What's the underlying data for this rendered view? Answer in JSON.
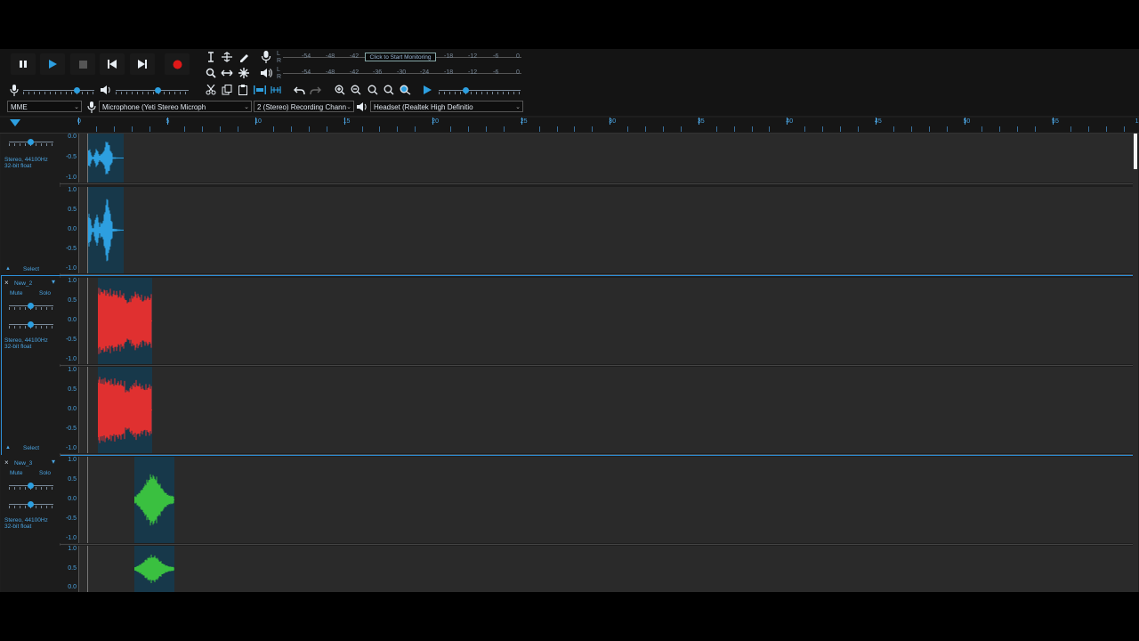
{
  "transport": {
    "pause": "pause-icon",
    "play": "play-icon",
    "stop": "stop-icon",
    "skip_start": "skip-start-icon",
    "skip_end": "skip-end-icon",
    "record": "record-icon"
  },
  "meters": {
    "record_labels": [
      "-54",
      "-48",
      "-42",
      "-18",
      "-12",
      "-6",
      "0"
    ],
    "monitor_button": "Click to Start Monitoring",
    "play_labels": [
      "-54",
      "-48",
      "-42",
      "-36",
      "-30",
      "-24",
      "-18",
      "-12",
      "-6",
      "0"
    ],
    "lr": [
      "L",
      "R"
    ]
  },
  "devices": {
    "host": "MME",
    "mic": "Microphone (Yeti Stereo Microph",
    "channels": "2 (Stereo) Recording Chann",
    "output": "Headset (Realtek High Definitio"
  },
  "ruler": {
    "ticks": [
      "0",
      "5",
      "10",
      "15",
      "20",
      "25",
      "30",
      "35",
      "40",
      "45",
      "50",
      "55",
      "1:00"
    ]
  },
  "tracks": [
    {
      "name": "",
      "info": "Stereo, 44100Hz\n32-bit float",
      "select": "Select",
      "color": "#2d9fe0",
      "scale_top": [
        "0.0",
        "-0.5",
        "-1.0"
      ],
      "scale": [
        "1.0",
        "0.5",
        "0.0",
        "-0.5",
        "-1.0"
      ]
    },
    {
      "name": "New_2",
      "mute": "Mute",
      "solo": "Solo",
      "info": "Stereo, 44100Hz\n32-bit float",
      "select": "Select",
      "color": "#e03030",
      "scale": [
        "1.0",
        "0.5",
        "0.0",
        "-0.5",
        "-1.0"
      ]
    },
    {
      "name": "New_3",
      "mute": "Mute",
      "solo": "Solo",
      "info": "Stereo, 44100Hz\n32-bit float",
      "color": "#3ac040",
      "scale": [
        "1.0",
        "0.5",
        "0.0",
        "-0.5",
        "-1.0"
      ],
      "scale_bottom": [
        "1.0",
        "0.5",
        "0.0"
      ]
    }
  ],
  "colors": {
    "accent": "#2d9fe0",
    "selected": "#2d8fd8",
    "clip_bg": "#17384a"
  }
}
